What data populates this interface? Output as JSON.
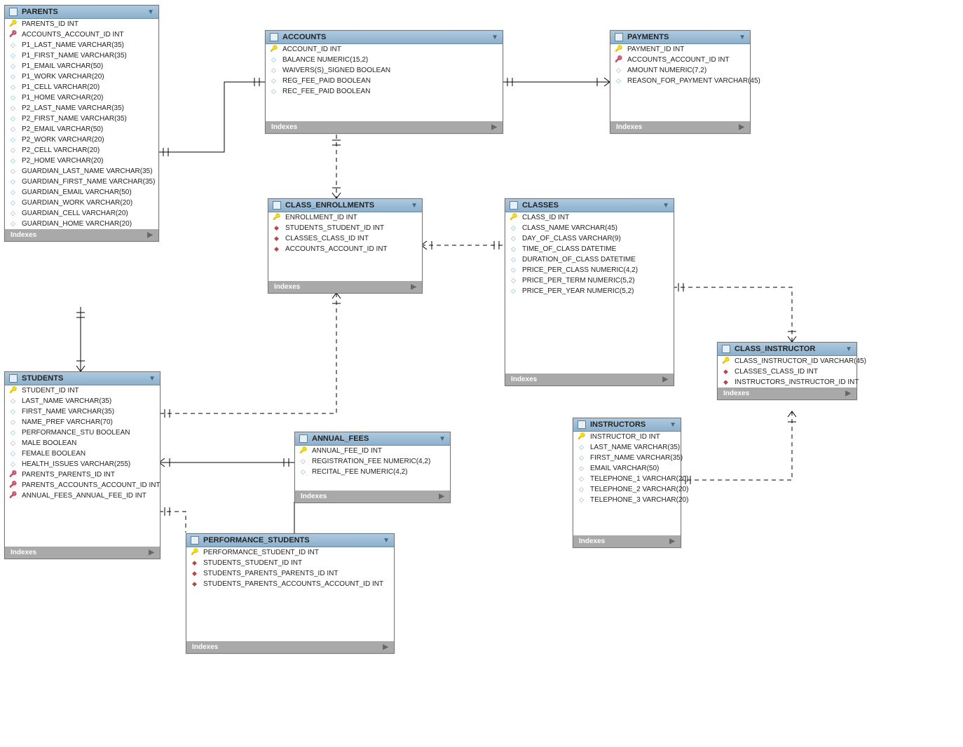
{
  "tables": {
    "parents": {
      "title": "PARENTS",
      "indexes": "Indexes",
      "cols": [
        {
          "k": "pk",
          "t": "PARENTS_ID INT"
        },
        {
          "k": "fk",
          "t": "ACCOUNTS_ACCOUNT_ID INT"
        },
        {
          "k": "attr",
          "t": "P1_LAST_NAME VARCHAR(35)"
        },
        {
          "k": "attr",
          "t": "P1_FIRST_NAME VARCHAR(35)"
        },
        {
          "k": "attr",
          "t": "P1_EMAIL VARCHAR(50)"
        },
        {
          "k": "attr",
          "t": "P1_WORK VARCHAR(20)"
        },
        {
          "k": "attr",
          "t": "P1_CELL VARCHAR(20)"
        },
        {
          "k": "attr",
          "t": "P1_HOME VARCHAR(20)"
        },
        {
          "k": "attr",
          "t": "P2_LAST_NAME VARCHAR(35)"
        },
        {
          "k": "attr",
          "t": "P2_FIRST_NAME VARCHAR(35)"
        },
        {
          "k": "attr",
          "t": "P2_EMAIL VARCHAR(50)"
        },
        {
          "k": "attr",
          "t": "P2_WORK VARCHAR(20)"
        },
        {
          "k": "attr",
          "t": "P2_CELL VARCHAR(20)"
        },
        {
          "k": "attr",
          "t": "P2_HOME VARCHAR(20)"
        },
        {
          "k": "attr",
          "t": "GUARDIAN_LAST_NAME VARCHAR(35)"
        },
        {
          "k": "attr",
          "t": "GUARDIAN_FIRST_NAME VARCHAR(35)"
        },
        {
          "k": "attr",
          "t": "GUARDIAN_EMAIL VARCHAR(50)"
        },
        {
          "k": "attr",
          "t": "GUARDIAN_WORK VARCHAR(20)"
        },
        {
          "k": "attr",
          "t": "GUARDIAN_CELL VARCHAR(20)"
        },
        {
          "k": "attr",
          "t": "GUARDIAN_HOME VARCHAR(20)"
        }
      ]
    },
    "accounts": {
      "title": "ACCOUNTS",
      "indexes": "Indexes",
      "cols": [
        {
          "k": "pk",
          "t": "ACCOUNT_ID INT"
        },
        {
          "k": "attr",
          "t": "BALANCE NUMERIC(15,2)"
        },
        {
          "k": "attr",
          "t": "WAIVERS(S)_SIGNED BOOLEAN"
        },
        {
          "k": "attr",
          "t": "REG_FEE_PAID BOOLEAN"
        },
        {
          "k": "attr",
          "t": "REC_FEE_PAID BOOLEAN"
        }
      ]
    },
    "payments": {
      "title": "PAYMENTS",
      "indexes": "Indexes",
      "cols": [
        {
          "k": "pk",
          "t": "PAYMENT_ID INT"
        },
        {
          "k": "fk",
          "t": "ACCOUNTS_ACCOUNT_ID INT"
        },
        {
          "k": "attr",
          "t": "AMOUNT NUMERIC(7,2)"
        },
        {
          "k": "attr",
          "t": "REASON_FOR_PAYMENT VARCHAR(45)"
        }
      ]
    },
    "class_enrollments": {
      "title": "CLASS_ENROLLMENTS",
      "indexes": "Indexes",
      "cols": [
        {
          "k": "pk",
          "t": "ENROLLMENT_ID INT"
        },
        {
          "k": "fkr",
          "t": "STUDENTS_STUDENT_ID INT"
        },
        {
          "k": "fkr",
          "t": "CLASSES_CLASS_ID INT"
        },
        {
          "k": "fkr",
          "t": "ACCOUNTS_ACCOUNT_ID INT"
        }
      ]
    },
    "classes": {
      "title": "CLASSES",
      "indexes": "Indexes",
      "cols": [
        {
          "k": "pk",
          "t": "CLASS_ID INT"
        },
        {
          "k": "attr",
          "t": "CLASS_NAME VARCHAR(45)"
        },
        {
          "k": "attr",
          "t": "DAY_OF_CLASS VARCHAR(9)"
        },
        {
          "k": "attr",
          "t": "TIME_OF_CLASS DATETIME"
        },
        {
          "k": "attr",
          "t": "DURATION_OF_CLASS DATETIME"
        },
        {
          "k": "attr",
          "t": "PRICE_PER_CLASS NUMERIC(4,2)"
        },
        {
          "k": "attr",
          "t": "PRICE_PER_TERM NUMERIC(5,2)"
        },
        {
          "k": "attr",
          "t": "PRICE_PER_YEAR NUMERIC(5,2)"
        }
      ]
    },
    "class_instructor": {
      "title": "CLASS_INSTRUCTOR",
      "indexes": "Indexes",
      "cols": [
        {
          "k": "pk",
          "t": "CLASS_INSTRUCTOR_ID VARCHAR(45)"
        },
        {
          "k": "fkr",
          "t": "CLASSES_CLASS_ID INT"
        },
        {
          "k": "fkr",
          "t": "INSTRUCTORS_INSTRUCTOR_ID INT"
        }
      ]
    },
    "students": {
      "title": "STUDENTS",
      "indexes": "Indexes",
      "cols": [
        {
          "k": "pk",
          "t": "STUDENT_ID INT"
        },
        {
          "k": "attr",
          "t": "LAST_NAME VARCHAR(35)"
        },
        {
          "k": "attr",
          "t": "FIRST_NAME VARCHAR(35)"
        },
        {
          "k": "attr",
          "t": "NAME_PREF VARCHAR(70)"
        },
        {
          "k": "attr",
          "t": "PERFORMANCE_STU BOOLEAN"
        },
        {
          "k": "attr",
          "t": "MALE BOOLEAN"
        },
        {
          "k": "attr",
          "t": "FEMALE BOOLEAN"
        },
        {
          "k": "attr",
          "t": "HEALTH_ISSUES VARCHAR(255)"
        },
        {
          "k": "fk",
          "t": "PARENTS_PARENTS_ID INT"
        },
        {
          "k": "fk",
          "t": "PARENTS_ACCOUNTS_ACCOUNT_ID INT"
        },
        {
          "k": "fk",
          "t": "ANNUAL_FEES_ANNUAL_FEE_ID INT"
        }
      ]
    },
    "annual_fees": {
      "title": "ANNUAL_FEES",
      "indexes": "Indexes",
      "cols": [
        {
          "k": "pk",
          "t": "ANNUAL_FEE_ID INT"
        },
        {
          "k": "attr",
          "t": "REGISTRATION_FEE NUMERIC(4,2)"
        },
        {
          "k": "attr",
          "t": "RECITAL_FEE NUMERIC(4,2)"
        }
      ]
    },
    "instructors": {
      "title": "INSTRUCTORS",
      "indexes": "Indexes",
      "cols": [
        {
          "k": "pk",
          "t": "INSTRUCTOR_ID INT"
        },
        {
          "k": "attr",
          "t": "LAST_NAME VARCHAR(35)"
        },
        {
          "k": "attr",
          "t": "FIRST_NAME VARCHAR(35)"
        },
        {
          "k": "attr",
          "t": "EMAIL VARCHAR(50)"
        },
        {
          "k": "attr",
          "t": "TELEPHONE_1 VARCHAR(20)"
        },
        {
          "k": "attr",
          "t": "TELEPHONE_2 VARCHAR(20)"
        },
        {
          "k": "attr",
          "t": "TELEPHONE_3 VARCHAR(20)"
        }
      ]
    },
    "performance_students": {
      "title": "PERFORMANCE_STUDENTS",
      "indexes": "Indexes",
      "cols": [
        {
          "k": "pk",
          "t": "PERFORMANCE_STUDENT_ID INT"
        },
        {
          "k": "fkr",
          "t": "STUDENTS_STUDENT_ID INT"
        },
        {
          "k": "fkr",
          "t": "STUDENTS_PARENTS_PARENTS_ID INT"
        },
        {
          "k": "fkr",
          "t": "STUDENTS_PARENTS_ACCOUNTS_ACCOUNT_ID INT"
        }
      ]
    }
  }
}
